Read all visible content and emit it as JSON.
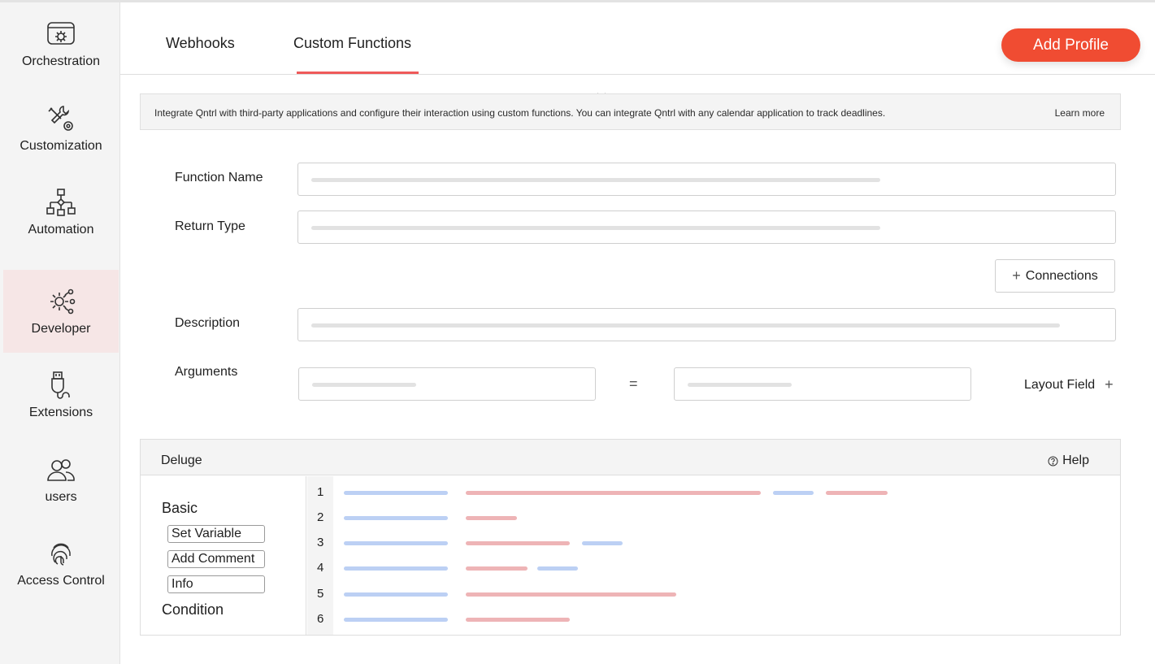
{
  "sidebar": {
    "items": [
      {
        "label": "Orchestration",
        "icon": "orchestration-icon"
      },
      {
        "label": "Customization",
        "icon": "customization-icon"
      },
      {
        "label": "Automation",
        "icon": "automation-icon"
      },
      {
        "label": "Developer",
        "icon": "developer-icon",
        "active": true
      },
      {
        "label": "Extensions",
        "icon": "extensions-icon"
      },
      {
        "label": "users",
        "icon": "users-icon"
      },
      {
        "label": "Access Control",
        "icon": "fingerprint-icon"
      }
    ]
  },
  "header": {
    "tabs": [
      {
        "label": "Webhooks"
      },
      {
        "label": "Custom Functions",
        "active": true
      }
    ],
    "add_profile_label": "Add Profile"
  },
  "banner": {
    "text": "Integrate Qntrl with third-party applications and configure their interaction using custom functions. You can integrate Qntrl with any calendar application to track deadlines.",
    "link": "Learn more"
  },
  "form": {
    "function_name_label": "Function Name",
    "return_type_label": "Return Type",
    "connections_label": "Connections",
    "description_label": "Description",
    "arguments_label": "Arguments",
    "equals": "=",
    "layout_field_label": "Layout Field",
    "plus": "+"
  },
  "deluge": {
    "title": "Deluge",
    "help_label": "Help",
    "basic_heading": "Basic",
    "basic_items": [
      "Set Variable",
      "Add Comment",
      "Info"
    ],
    "condition_heading": "Condition",
    "line_numbers": [
      "1",
      "2",
      "3",
      "4",
      "5",
      "6"
    ]
  },
  "colors": {
    "accent": "#f04c32",
    "tab_underline": "#ef5a5a",
    "active_sidebar_bg": "#f6e6e6",
    "code_blue": "#bcd0f4",
    "code_red": "#eeb4b6",
    "placeholder": "#e2e2e2"
  }
}
